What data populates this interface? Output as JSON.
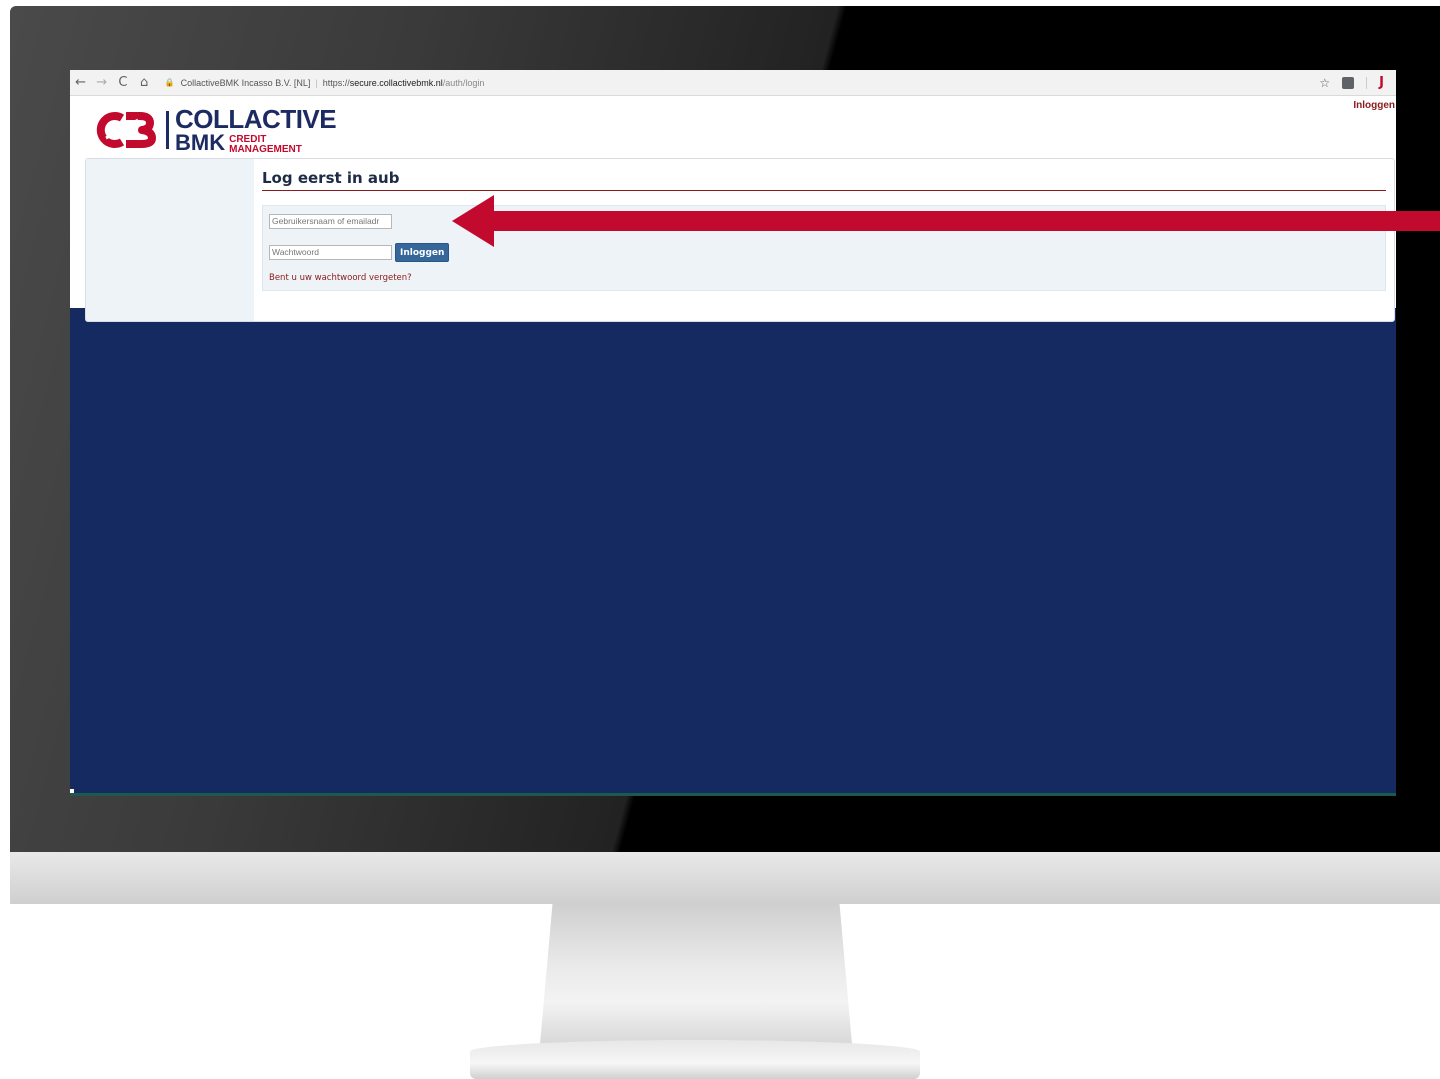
{
  "browser": {
    "back_glyph": "←",
    "forward_glyph": "→",
    "reload_glyph": "C",
    "home_glyph": "⌂",
    "lock_glyph": "🔒",
    "site_name": "CollactiveBMK Incasso B.V. [NL]",
    "separator": "|",
    "url_scheme": "https://",
    "url_host": "secure.collactivebmk.nl",
    "url_path": "/auth/login",
    "star_glyph": "☆",
    "profile_glyph": "J"
  },
  "header": {
    "top_login_link": "Inloggen",
    "logo": {
      "line1": "COLLACTIVE",
      "line2": "BMK",
      "sub1": "CREDIT",
      "sub2": "MANAGEMENT"
    }
  },
  "main": {
    "title": "Log eerst in aub",
    "username_placeholder": "Gebruikersnaam of emailadr",
    "password_placeholder": "Wachtwoord",
    "login_button": "Inloggen",
    "forgot_link": "Bent u uw wachtwoord vergeten?"
  },
  "colors": {
    "brand_navy": "#1d2b63",
    "brand_red": "#c20a2f",
    "screen_background": "#162a62",
    "button_blue": "#36679b",
    "link_red": "#8b1a1a",
    "arrow_red": "#c20a2f"
  }
}
